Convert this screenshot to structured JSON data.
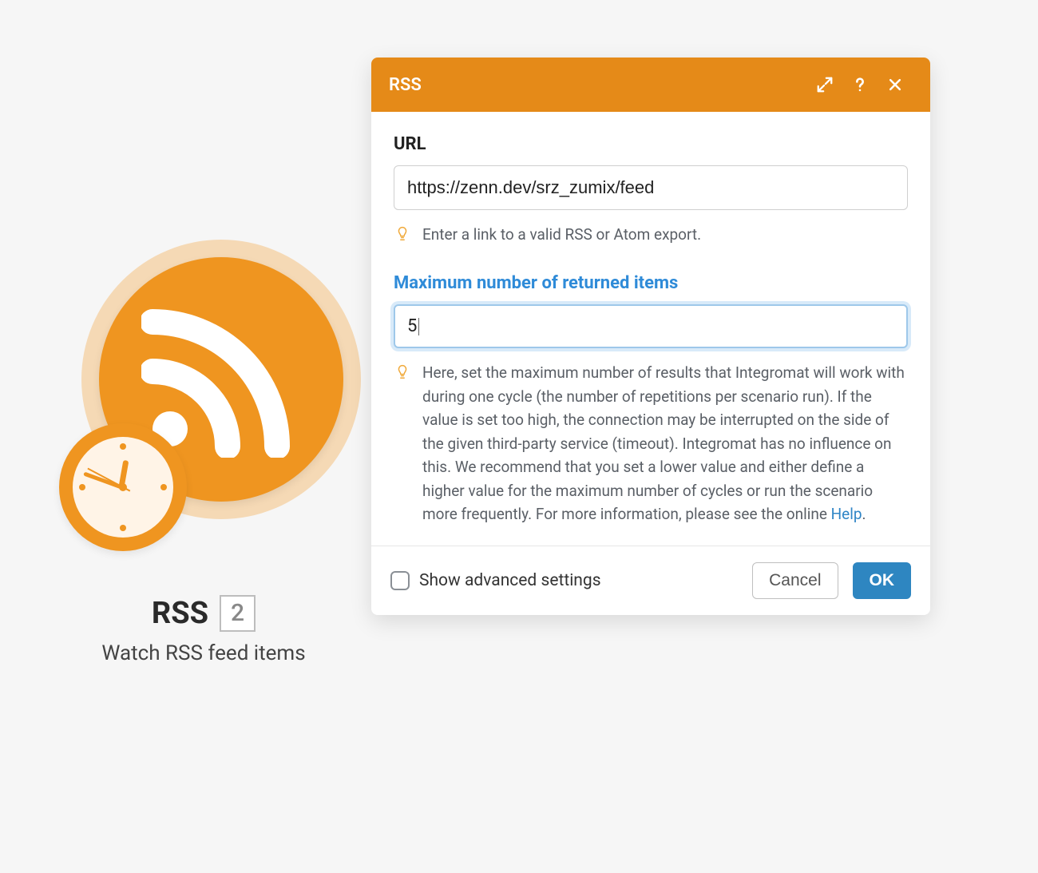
{
  "node": {
    "title": "RSS",
    "badge": "2",
    "subtitle": "Watch RSS feed items"
  },
  "dialog": {
    "title": "RSS",
    "url_label": "URL",
    "url_value": "https://zenn.dev/srz_zumix/feed",
    "url_hint": "Enter a link to a valid RSS or Atom export.",
    "max_label": "Maximum number of returned items",
    "max_value": "5",
    "max_hint_prefix": "Here, set the maximum number of results that Integromat will work with during one cycle (the number of repetitions per scenario run). If the value is set too high, the connection may be interrupted on the side of the given third-party service (timeout). Integromat has no influence on this. We recommend that you set a lower value and either define a higher value for the maximum number of cycles or run the scenario more frequently. For more information, please see the online ",
    "max_hint_link": "Help",
    "max_hint_suffix": ".",
    "advanced_label": "Show advanced settings",
    "cancel": "Cancel",
    "ok": "OK"
  }
}
